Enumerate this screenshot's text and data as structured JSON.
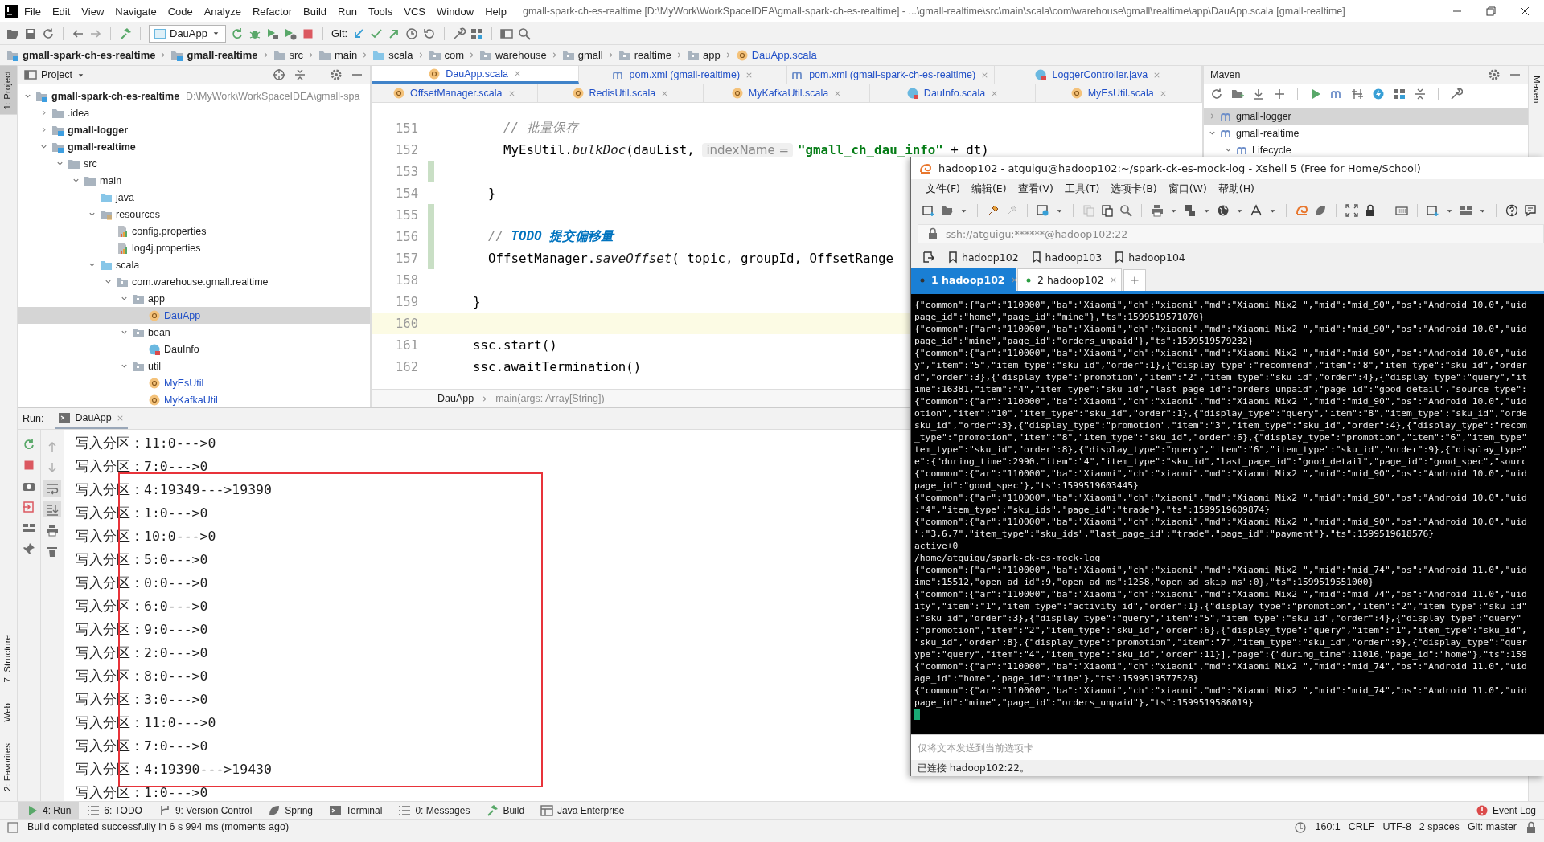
{
  "ide": {
    "menu": [
      "File",
      "Edit",
      "View",
      "Navigate",
      "Code",
      "Analyze",
      "Refactor",
      "Build",
      "Run",
      "Tools",
      "VCS",
      "Window",
      "Help"
    ],
    "title": "gmall-spark-ch-es-realtime [D:\\MyWork\\WorkSpaceIDEA\\gmall-spark-ch-es-realtime] - ...\\gmall-realtime\\src\\main\\scala\\com\\warehouse\\gmall\\realtime\\app\\DauApp.scala [gmall-realtime]",
    "run_config": "DauApp",
    "git_label": "Git:",
    "breadcrumbs": [
      {
        "label": "gmall-spark-ch-es-realtime",
        "kind": "module"
      },
      {
        "label": "gmall-realtime",
        "kind": "module"
      },
      {
        "label": "src",
        "kind": "folder"
      },
      {
        "label": "main",
        "kind": "folder"
      },
      {
        "label": "scala",
        "kind": "source"
      },
      {
        "label": "com",
        "kind": "package"
      },
      {
        "label": "warehouse",
        "kind": "package"
      },
      {
        "label": "gmall",
        "kind": "package"
      },
      {
        "label": "realtime",
        "kind": "package"
      },
      {
        "label": "app",
        "kind": "package"
      },
      {
        "label": "DauApp.scala",
        "kind": "object"
      }
    ],
    "left_strip": [
      {
        "label": "1: Project",
        "kind": "top",
        "selected": true
      },
      {
        "label": "7: Structure",
        "kind": "bottom",
        "selected": false
      },
      {
        "label": "Web",
        "kind": "bottom",
        "selected": false
      },
      {
        "label": "2: Favorites",
        "kind": "bottom",
        "selected": false
      }
    ],
    "right_strip": [
      {
        "label": "Maven",
        "selected": false
      }
    ],
    "project": {
      "title": "Project",
      "tree": [
        {
          "label": "gmall-spark-ch-es-realtime",
          "path": "D:\\MyWork\\WorkSpaceIDEA\\gmall-spa",
          "kind": "module",
          "expanded": true,
          "selected": false,
          "children": [
            {
              "label": ".idea",
              "kind": "folder",
              "expanded": false,
              "selected": false
            },
            {
              "label": "gmall-logger",
              "kind": "module",
              "expanded": false,
              "selected": false
            },
            {
              "label": "gmall-realtime",
              "kind": "module",
              "expanded": true,
              "selected": false,
              "children": [
                {
                  "label": "src",
                  "kind": "folder",
                  "expanded": true,
                  "selected": false,
                  "children": [
                    {
                      "label": "main",
                      "kind": "folder",
                      "expanded": true,
                      "selected": false,
                      "children": [
                        {
                          "label": "java",
                          "kind": "source",
                          "selected": false
                        },
                        {
                          "label": "resources",
                          "kind": "resources",
                          "expanded": true,
                          "selected": false,
                          "children": [
                            {
                              "label": "config.properties",
                              "kind": "props",
                              "selected": false
                            },
                            {
                              "label": "log4j.properties",
                              "kind": "props",
                              "selected": false
                            }
                          ]
                        },
                        {
                          "label": "scala",
                          "kind": "source",
                          "expanded": true,
                          "selected": false,
                          "children": [
                            {
                              "label": "com.warehouse.gmall.realtime",
                              "kind": "package",
                              "expanded": true,
                              "selected": false,
                              "children": [
                                {
                                  "label": "app",
                                  "kind": "package",
                                  "expanded": true,
                                  "selected": false,
                                  "children": [
                                    {
                                      "label": "DauApp",
                                      "kind": "object",
                                      "selected": true
                                    }
                                  ]
                                },
                                {
                                  "label": "bean",
                                  "kind": "package",
                                  "expanded": true,
                                  "selected": false,
                                  "children": [
                                    {
                                      "label": "DauInfo",
                                      "kind": "class",
                                      "selected": false
                                    }
                                  ]
                                },
                                {
                                  "label": "util",
                                  "kind": "package",
                                  "expanded": true,
                                  "selected": false,
                                  "children": [
                                    {
                                      "label": "MyEsUtil",
                                      "kind": "object",
                                      "selected": false
                                    },
                                    {
                                      "label": "MyKafkaUtil",
                                      "kind": "object",
                                      "selected": false
                                    }
                                  ]
                                }
                              ]
                            }
                          ]
                        }
                      ]
                    }
                  ]
                }
              ]
            }
          ]
        }
      ]
    },
    "editor": {
      "tabs_row_1": [
        {
          "label": "DauApp.scala",
          "kind": "object",
          "selected": true
        },
        {
          "label": "pom.xml (gmall-realtime)",
          "kind": "maven",
          "selected": false
        },
        {
          "label": "pom.xml (gmall-spark-ch-es-realtime)",
          "kind": "maven",
          "selected": false
        },
        {
          "label": "LoggerController.java",
          "kind": "class",
          "selected": false
        }
      ],
      "tabs_row_2": [
        {
          "label": "OffsetManager.scala",
          "kind": "object",
          "selected": false
        },
        {
          "label": "RedisUtil.scala",
          "kind": "object",
          "selected": false
        },
        {
          "label": "MyKafkaUtil.scala",
          "kind": "object",
          "selected": false
        },
        {
          "label": "DauInfo.scala",
          "kind": "class",
          "selected": false
        },
        {
          "label": "MyEsUtil.scala",
          "kind": "object",
          "selected": false
        }
      ],
      "lines": [
        {
          "number": "151",
          "changed": false,
          "current": false,
          "segments": [
            {
              "text": "        // 批量保存",
              "kind": "comment"
            }
          ]
        },
        {
          "number": "152",
          "changed": false,
          "current": false,
          "segments": [
            {
              "text": "        MyEsUtil.",
              "kind": "plain"
            },
            {
              "text": "bulkDoc",
              "kind": "method"
            },
            {
              "text": "(dauList, ",
              "kind": "plain"
            },
            {
              "text": "indexName =",
              "kind": "hint"
            },
            {
              "text": "\"gmall_ch_dau_info\"",
              "kind": "string"
            },
            {
              "text": " + dt)",
              "kind": "plain"
            }
          ]
        },
        {
          "number": "153",
          "changed": true,
          "current": false
        },
        {
          "number": "154",
          "changed": false,
          "current": false,
          "segments": [
            {
              "text": "      }",
              "kind": "plain"
            }
          ]
        },
        {
          "number": "155",
          "changed": true,
          "current": false
        },
        {
          "number": "156",
          "changed": true,
          "current": false,
          "segments": [
            {
              "text": "      // ",
              "kind": "comment"
            },
            {
              "text": "TODO 提交偏移量",
              "kind": "todo"
            }
          ]
        },
        {
          "number": "157",
          "changed": true,
          "current": false,
          "segments": [
            {
              "text": "      OffsetManager.",
              "kind": "plain"
            },
            {
              "text": "saveOffset",
              "kind": "method"
            },
            {
              "text": "( topic, groupId, OffsetRange",
              "kind": "plain"
            }
          ]
        },
        {
          "number": "158",
          "changed": false,
          "current": false
        },
        {
          "number": "159",
          "changed": false,
          "current": false,
          "segments": [
            {
              "text": "    }",
              "kind": "plain"
            }
          ]
        },
        {
          "number": "160",
          "changed": false,
          "current": true
        },
        {
          "number": "161",
          "changed": false,
          "current": false,
          "segments": [
            {
              "text": "    ssc.start()",
              "kind": "plain"
            }
          ]
        },
        {
          "number": "162",
          "changed": false,
          "current": false,
          "segments": [
            {
              "text": "    ssc.awaitTermination()",
              "kind": "plain"
            }
          ]
        }
      ],
      "breadcrumb": [
        "DauApp",
        "main(args: Array[String])"
      ]
    },
    "maven": {
      "title": "Maven",
      "tree": [
        {
          "label": "gmall-logger",
          "expanded": false,
          "selected": true
        },
        {
          "label": "gmall-realtime",
          "expanded": true,
          "selected": false,
          "children": [
            {
              "label": "Lifecycle",
              "expanded": true,
              "selected": false
            }
          ]
        }
      ]
    },
    "run": {
      "label": "Run:",
      "tab": "DauApp",
      "output": [
        {
          "prefix": "写入分区：",
          "value": "11:0--->0",
          "highlighted": false
        },
        {
          "prefix": "写入分区：",
          "value": "7:0--->0",
          "highlighted": false
        },
        {
          "prefix": "写入分区：",
          "value": "4:19349--->19390",
          "highlighted": true
        },
        {
          "prefix": "写入分区：",
          "value": "1:0--->0",
          "highlighted": true
        },
        {
          "prefix": "写入分区：",
          "value": "10:0--->0",
          "highlighted": true
        },
        {
          "prefix": "写入分区：",
          "value": "5:0--->0",
          "highlighted": true
        },
        {
          "prefix": "写入分区：",
          "value": "0:0--->0",
          "highlighted": true
        },
        {
          "prefix": "写入分区：",
          "value": "6:0--->0",
          "highlighted": true
        },
        {
          "prefix": "写入分区：",
          "value": "9:0--->0",
          "highlighted": true
        },
        {
          "prefix": "写入分区：",
          "value": "2:0--->0",
          "highlighted": true
        },
        {
          "prefix": "写入分区：",
          "value": "8:0--->0",
          "highlighted": true
        },
        {
          "prefix": "写入分区：",
          "value": "3:0--->0",
          "highlighted": true
        },
        {
          "prefix": "写入分区：",
          "value": "11:0--->0",
          "highlighted": true
        },
        {
          "prefix": "写入分区：",
          "value": "7:0--->0",
          "highlighted": true
        },
        {
          "prefix": "写入分区：",
          "value": "4:19390--->19430",
          "highlighted": true
        },
        {
          "prefix": "写入分区：",
          "value": "1:0--->0",
          "highlighted": false
        }
      ]
    },
    "tool_tabs": [
      {
        "label": "4: Run",
        "kind": "run",
        "selected": true
      },
      {
        "label": "6: TODO",
        "kind": "list",
        "selected": false
      },
      {
        "label": "9: Version Control",
        "kind": "branch",
        "selected": false
      },
      {
        "label": "Spring",
        "kind": "leaf",
        "selected": false
      },
      {
        "label": "Terminal",
        "kind": "terminal",
        "selected": false
      },
      {
        "label": "0: Messages",
        "kind": "list",
        "selected": false
      },
      {
        "label": "Build",
        "kind": "hammer",
        "selected": false
      },
      {
        "label": "Java Enterprise",
        "kind": "grid",
        "selected": false
      }
    ],
    "event_log": "Event Log",
    "status": {
      "message": "Build completed successfully in 6 s 994 ms (moments ago)",
      "items": [
        "160:1",
        "CRLF",
        "UTF-8",
        "2 spaces",
        "Git: master"
      ]
    }
  },
  "xshell": {
    "title": "hadoop102 - atguigu@hadoop102:~/spark-ck-es-mock-log - Xshell 5 (Free for Home/School)",
    "menu": [
      "文件(F)",
      "编辑(E)",
      "查看(V)",
      "工具(T)",
      "选项卡(B)",
      "窗口(W)",
      "帮助(H)"
    ],
    "address": "ssh://atguigu:******@hadoop102:22",
    "bookmarks": [
      "hadoop102",
      "hadoop103",
      "hadoop104"
    ],
    "tabs": [
      {
        "label": "1 hadoop102",
        "selected": true
      },
      {
        "label": "2 hadoop102",
        "selected": false
      }
    ],
    "lines": [
      "{\"common\":{\"ar\":\"110000\",\"ba\":\"Xiaomi\",\"ch\":\"xiaomi\",\"md\":\"Xiaomi Mix2 \",\"mid\":\"mid_90\",\"os\":\"Android 10.0\",\"uid",
      "page_id\":\"home\",\"page_id\":\"mine\"},\"ts\":1599519571070}",
      "{\"common\":{\"ar\":\"110000\",\"ba\":\"Xiaomi\",\"ch\":\"xiaomi\",\"md\":\"Xiaomi Mix2 \",\"mid\":\"mid_90\",\"os\":\"Android 10.0\",\"uid",
      "page_id\":\"mine\",\"page_id\":\"orders_unpaid\"},\"ts\":1599519579232}",
      "{\"common\":{\"ar\":\"110000\",\"ba\":\"Xiaomi\",\"ch\":\"xiaomi\",\"md\":\"Xiaomi Mix2 \",\"mid\":\"mid_90\",\"os\":\"Android 10.0\",\"uid",
      "y\",\"item\":\"5\",\"item_type\":\"sku_id\",\"order\":1},{\"display_type\":\"recommend\",\"item\":\"8\",\"item_type\":\"sku_id\",\"order",
      "d\",\"order\":3},{\"display_type\":\"promotion\",\"item\":\"2\",\"item_type\":\"sku_id\",\"order\":4},{\"display_type\":\"query\",\"it",
      "ime\":16381,\"item\":\"4\",\"item_type\":\"sku_id\",\"last_page_id\":\"orders_unpaid\",\"page_id\":\"good_detail\",\"source_type\":",
      "{\"common\":{\"ar\":\"110000\",\"ba\":\"Xiaomi\",\"ch\":\"xiaomi\",\"md\":\"Xiaomi Mix2 \",\"mid\":\"mid_90\",\"os\":\"Android 10.0\",\"uid",
      "otion\",\"item\":\"10\",\"item_type\":\"sku_id\",\"order\":1},{\"display_type\":\"query\",\"item\":\"8\",\"item_type\":\"sku_id\",\"orde",
      "sku_id\",\"order\":3},{\"display_type\":\"promotion\",\"item\":\"3\",\"item_type\":\"sku_id\",\"order\":4},{\"display_type\":\"recom",
      "_type\":\"promotion\",\"item\":\"8\",\"item_type\":\"sku_id\",\"order\":6},{\"display_type\":\"promotion\",\"item\":\"6\",\"item_type\"",
      "tem_type\":\"sku_id\",\"order\":8},{\"display_type\":\"query\",\"item\":\"6\",\"item_type\":\"sku_id\",\"order\":9},{\"display_type\"",
      "e\":{\"during_time\":2990,\"item\":\"4\",\"item_type\":\"sku_id\",\"last_page_id\":\"good_detail\",\"page_id\":\"good_spec\",\"sourc",
      "{\"common\":{\"ar\":\"110000\",\"ba\":\"Xiaomi\",\"ch\":\"xiaomi\",\"md\":\"Xiaomi Mix2 \",\"mid\":\"mid_90\",\"os\":\"Android 10.0\",\"uid",
      "page_id\":\"good_spec\"},\"ts\":1599519603445}",
      "{\"common\":{\"ar\":\"110000\",\"ba\":\"Xiaomi\",\"ch\":\"xiaomi\",\"md\":\"Xiaomi Mix2 \",\"mid\":\"mid_90\",\"os\":\"Android 10.0\",\"uid",
      ":\"4\",\"item_type\":\"sku_ids\",\"page_id\":\"trade\"},\"ts\":1599519609874}",
      "{\"common\":{\"ar\":\"110000\",\"ba\":\"Xiaomi\",\"ch\":\"xiaomi\",\"md\":\"Xiaomi Mix2 \",\"mid\":\"mid_90\",\"os\":\"Android 10.0\",\"uid",
      "\":\"3,6,7\",\"item_type\":\"sku_ids\",\"last_page_id\":\"trade\",\"page_id\":\"payment\"},\"ts\":1599519618576}",
      "active+0",
      "/home/atguigu/spark-ck-es-mock-log",
      "{\"common\":{\"ar\":\"110000\",\"ba\":\"Xiaomi\",\"ch\":\"xiaomi\",\"md\":\"Xiaomi Mix2 \",\"mid\":\"mid_74\",\"os\":\"Android 11.0\",\"uid",
      "ime\":15512,\"open_ad_id\":9,\"open_ad_ms\":1258,\"open_ad_skip_ms\":0},\"ts\":1599519551000}",
      "{\"common\":{\"ar\":\"110000\",\"ba\":\"Xiaomi\",\"ch\":\"xiaomi\",\"md\":\"Xiaomi Mix2 \",\"mid\":\"mid_74\",\"os\":\"Android 11.0\",\"uid",
      "ity\",\"item\":\"1\",\"item_type\":\"activity_id\",\"order\":1},{\"display_type\":\"promotion\",\"item\":\"2\",\"item_type\":\"sku_id\"",
      ":\"sku_id\",\"order\":3},{\"display_type\":\"query\",\"item\":\"5\",\"item_type\":\"sku_id\",\"order\":4},{\"display_type\":\"query\"",
      ":\"promotion\",\"item\":\"2\",\"item_type\":\"sku_id\",\"order\":6},{\"display_type\":\"query\",\"item\":\"1\",\"item_type\":\"sku_id\",",
      "\"sku_id\",\"order\":8},{\"display_type\":\"promotion\",\"item\":\"7\",\"item_type\":\"sku_id\",\"order\":9},{\"display_type\":\"quer",
      "ype\":\"query\",\"item\":\"4\",\"item_type\":\"sku_id\",\"order\":11}],\"page\":{\"during_time\":11016,\"page_id\":\"home\"},\"ts\":159",
      "{\"common\":{\"ar\":\"110000\",\"ba\":\"Xiaomi\",\"ch\":\"xiaomi\",\"md\":\"Xiaomi Mix2 \",\"mid\":\"mid_74\",\"os\":\"Android 11.0\",\"uid",
      "age_id\":\"home\",\"page_id\":\"mine\"},\"ts\":1599519577528}",
      "{\"common\":{\"ar\":\"110000\",\"ba\":\"Xiaomi\",\"ch\":\"xiaomi\",\"md\":\"Xiaomi Mix2 \",\"mid\":\"mid_74\",\"os\":\"Android 11.0\",\"uid",
      "page_id\":\"mine\",\"page_id\":\"orders_unpaid\"},\"ts\":1599519586019}"
    ],
    "send_placeholder": "仅将文本发送到当前选项卡",
    "status": "已连接 hadoop102:22。"
  }
}
